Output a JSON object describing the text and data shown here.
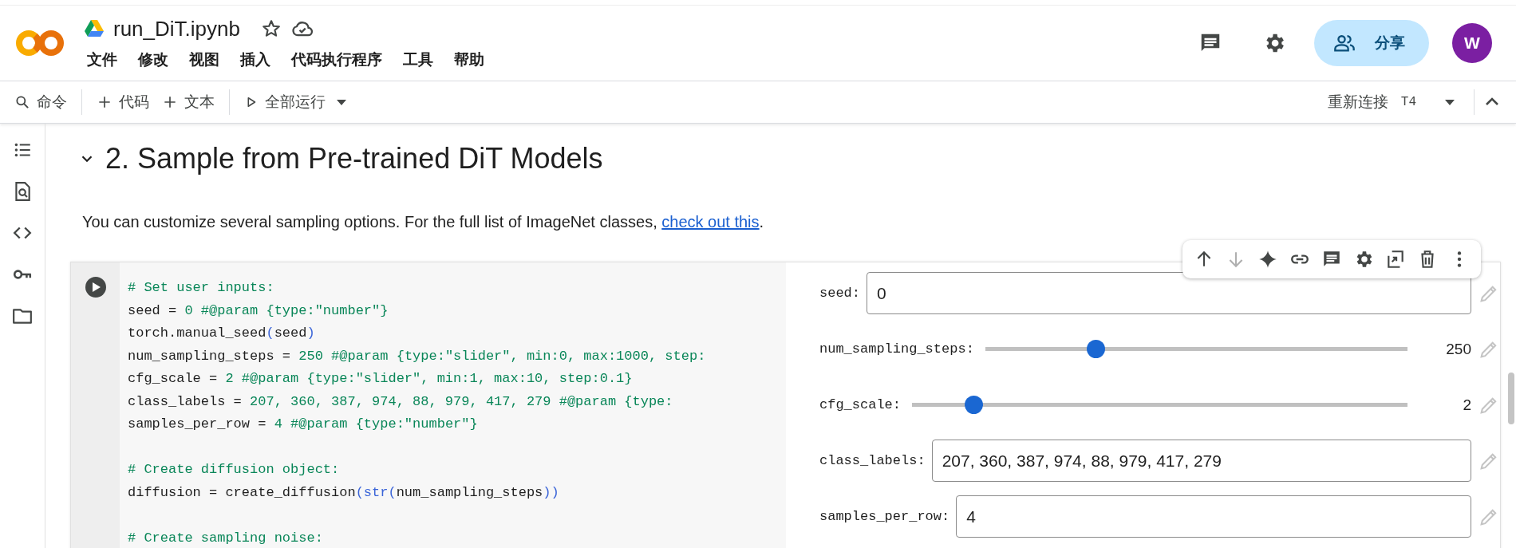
{
  "header": {
    "notebook_title": "run_DiT.ipynb",
    "menu": [
      "文件",
      "修改",
      "视图",
      "插入",
      "代码执行程序",
      "工具",
      "帮助"
    ],
    "share_button": "分享",
    "avatar": "W"
  },
  "toolbar": {
    "command": "命令",
    "add_code": "代码",
    "add_text": "文本",
    "run_all": "全部运行",
    "reconnect": "重新连接",
    "runtime": "T4"
  },
  "section": {
    "expanded": true,
    "heading": "2. Sample from Pre-trained DiT Models",
    "intro": "You can customize several sampling options. For the full list of ImageNet classes, ",
    "link": "check out this",
    "intro_end": "."
  },
  "cell": {
    "code_lines": [
      {
        "blank_before": false,
        "segments": [
          {
            "kind": "comment",
            "text": "# Set user inputs:"
          }
        ]
      },
      {
        "blank_before": false,
        "segments": [
          {
            "kind": "plain",
            "text": "seed = "
          },
          {
            "kind": "number",
            "text": "0"
          },
          {
            "kind": "comment",
            "text": " #@param {type:\"number\"}"
          }
        ]
      },
      {
        "blank_before": false,
        "segments": [
          {
            "kind": "plain",
            "text": "torch.manual_seed"
          },
          {
            "kind": "bracket",
            "text": "("
          },
          {
            "kind": "plain",
            "text": "seed"
          },
          {
            "kind": "bracket",
            "text": ")"
          }
        ]
      },
      {
        "blank_before": false,
        "segments": [
          {
            "kind": "plain",
            "text": "num_sampling_steps = "
          },
          {
            "kind": "number",
            "text": "250"
          },
          {
            "kind": "comment",
            "text": " #@param {type:\"slider\", min:0, max:1000, step:"
          }
        ]
      },
      {
        "blank_before": false,
        "segments": [
          {
            "kind": "plain",
            "text": "cfg_scale = "
          },
          {
            "kind": "number",
            "text": "2"
          },
          {
            "kind": "comment",
            "text": " #@param {type:\"slider\", min:1, max:10, step:0.1}"
          }
        ]
      },
      {
        "blank_before": false,
        "segments": [
          {
            "kind": "plain",
            "text": "class_labels = "
          },
          {
            "kind": "number",
            "text": "207, 360, 387, 974, 88, 979, 417, 279"
          },
          {
            "kind": "comment",
            "text": " #@param {type:"
          }
        ]
      },
      {
        "blank_before": false,
        "segments": [
          {
            "kind": "plain",
            "text": "samples_per_row = "
          },
          {
            "kind": "number",
            "text": "4"
          },
          {
            "kind": "comment",
            "text": " #@param {type:\"number\"}"
          }
        ]
      },
      {
        "blank_before": true,
        "segments": [
          {
            "kind": "comment",
            "text": "# Create diffusion object:"
          }
        ]
      },
      {
        "blank_before": false,
        "segments": [
          {
            "kind": "plain",
            "text": "diffusion = create_diffusion"
          },
          {
            "kind": "bracket",
            "text": "("
          },
          {
            "kind": "builtin",
            "text": "str"
          },
          {
            "kind": "bracket",
            "text": "("
          },
          {
            "kind": "plain",
            "text": "num_sampling_steps"
          },
          {
            "kind": "bracket",
            "text": "))"
          }
        ]
      },
      {
        "blank_before": true,
        "segments": [
          {
            "kind": "comment",
            "text": "# Create sampling noise:"
          }
        ]
      }
    ],
    "form": [
      {
        "kind": "input",
        "label": "seed:",
        "value": "0"
      },
      {
        "kind": "slider",
        "label": "num_sampling_steps:",
        "level": 0.25,
        "reading": "250"
      },
      {
        "kind": "slider",
        "label": "cfg_scale:",
        "level": 0.11,
        "reading": "2"
      },
      {
        "kind": "input",
        "label": "class_labels:",
        "value": "207, 360, 387, 974, 88, 979, 417, 279"
      },
      {
        "kind": "input",
        "label": "samples_per_row:",
        "value": "4"
      }
    ]
  }
}
